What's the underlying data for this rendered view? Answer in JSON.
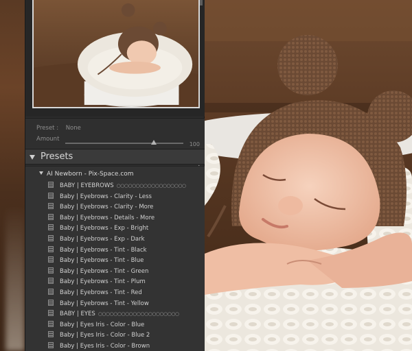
{
  "presetInfo": {
    "presetLabel": "Preset :",
    "presetValue": "None",
    "amountLabel": "Amount",
    "amountValue": "100"
  },
  "presets": {
    "title": "Presets",
    "addSymbol": "+",
    "folder": "AI Newborn - Pix-Space.com",
    "items": [
      {
        "label": "BABY | EYEBROWS",
        "ornament": "○○○○○○○○○○○○○○○○○○"
      },
      {
        "label": "Baby | Eyebrows - Clarity - Less"
      },
      {
        "label": "Baby | Eyebrows - Clarity - More"
      },
      {
        "label": "Baby | Eyebrows - Details - More"
      },
      {
        "label": "Baby | Eyebrows - Exp - Bright"
      },
      {
        "label": "Baby | Eyebrows - Exp - Dark"
      },
      {
        "label": "Baby | Eyebrows - Tint - Black"
      },
      {
        "label": "Baby | Eyebrows - Tint - Blue"
      },
      {
        "label": "Baby | Eyebrows - Tint - Green"
      },
      {
        "label": "Baby | Eyebrows - Tint - Plum"
      },
      {
        "label": "Baby | Eyebrows - Tint - Red"
      },
      {
        "label": "Baby | Eyebrows - Tint - Yellow"
      },
      {
        "label": "BABY | EYES",
        "ornament": "○○○○○○○○○○○○○○○○○○○○○"
      },
      {
        "label": "Baby | Eyes Iris - Color - Blue"
      },
      {
        "label": "Baby | Eyes Iris - Color - Blue 2"
      },
      {
        "label": "Baby | Eyes Iris - Color - Brown"
      }
    ]
  },
  "slider": {
    "amountFraction": 0.75
  },
  "colors": {
    "panel": "#2c2c2c",
    "panelText": "#d2d2d2",
    "headerBg": "#3a3a3a"
  }
}
